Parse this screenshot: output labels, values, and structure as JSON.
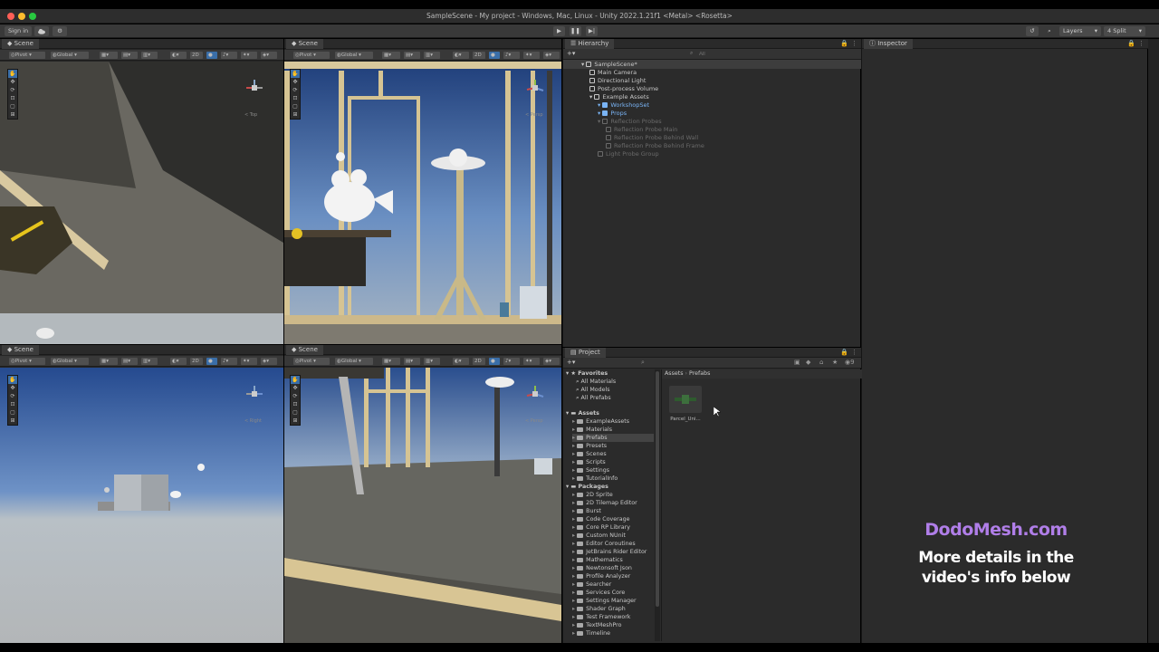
{
  "window": {
    "title": "SampleScene - My project - Windows, Mac, Linux - Unity 2022.1.21f1 <Metal> <Rosetta>"
  },
  "toolbar": {
    "sign_in": "Sign in",
    "layers": "Layers",
    "layout": "4 Split"
  },
  "scene_views": [
    {
      "tab": "Scene",
      "pivot": "Pivot",
      "global": "Global",
      "mode2d": "2D",
      "view_label": "< Top"
    },
    {
      "tab": "Scene",
      "pivot": "Pivot",
      "global": "Global",
      "mode2d": "2D",
      "view_label": "< Persp"
    },
    {
      "tab": "Scene",
      "pivot": "Pivot",
      "global": "Global",
      "mode2d": "2D",
      "view_label": "< Right"
    },
    {
      "tab": "Scene",
      "pivot": "Pivot",
      "global": "Global",
      "mode2d": "2D",
      "view_label": "< Persp"
    }
  ],
  "hierarchy": {
    "tab": "Hierarchy",
    "search_placeholder": "All",
    "items": [
      {
        "label": "SampleScene*",
        "depth": 0,
        "kind": "scene"
      },
      {
        "label": "Main Camera",
        "depth": 1,
        "kind": "object"
      },
      {
        "label": "Directional Light",
        "depth": 1,
        "kind": "object"
      },
      {
        "label": "Post-process Volume",
        "depth": 1,
        "kind": "object"
      },
      {
        "label": "Example Assets",
        "depth": 1,
        "kind": "object"
      },
      {
        "label": "WorkshopSet",
        "depth": 2,
        "kind": "prefab"
      },
      {
        "label": "Props",
        "depth": 2,
        "kind": "prefab"
      },
      {
        "label": "Reflection Probes",
        "depth": 2,
        "kind": "disabled"
      },
      {
        "label": "Reflection Probe Main",
        "depth": 3,
        "kind": "disabled"
      },
      {
        "label": "Reflection Probe Behind Wall",
        "depth": 3,
        "kind": "disabled"
      },
      {
        "label": "Reflection Probe Behind Frame",
        "depth": 3,
        "kind": "disabled"
      },
      {
        "label": "Light Probe Group",
        "depth": 2,
        "kind": "disabled"
      }
    ]
  },
  "inspector": {
    "tab": "Inspector"
  },
  "project": {
    "tab": "Project",
    "breadcrumb": [
      "Assets",
      "Prefabs"
    ],
    "favorites_label": "Favorites",
    "favorites": [
      "All Materials",
      "All Models",
      "All Prefabs"
    ],
    "assets_label": "Assets",
    "assets": [
      "ExampleAssets",
      "Materials",
      "Prefabs",
      "Presets",
      "Scenes",
      "Scripts",
      "Settings",
      "TutorialInfo"
    ],
    "selected_asset": "Prefabs",
    "packages_label": "Packages",
    "packages": [
      "2D Sprite",
      "2D Tilemap Editor",
      "Burst",
      "Code Coverage",
      "Core RP Library",
      "Custom NUnit",
      "Editor Coroutines",
      "JetBrains Rider Editor",
      "Mathematics",
      "Newtonsoft Json",
      "Profile Analyzer",
      "Searcher",
      "Services Core",
      "Settings Manager",
      "Shader Graph",
      "Test Framework",
      "TextMeshPro",
      "Timeline"
    ],
    "asset_items": [
      {
        "label": "Parcel_Uni..."
      }
    ]
  },
  "watermark": {
    "site": "DodoMesh.com",
    "line1": "More details in the",
    "line2": "video's info below"
  },
  "colors": {
    "accent": "#3a6ea8",
    "watermark_purple": "#b07ee8",
    "prefab_blue": "#7ab4f5"
  }
}
